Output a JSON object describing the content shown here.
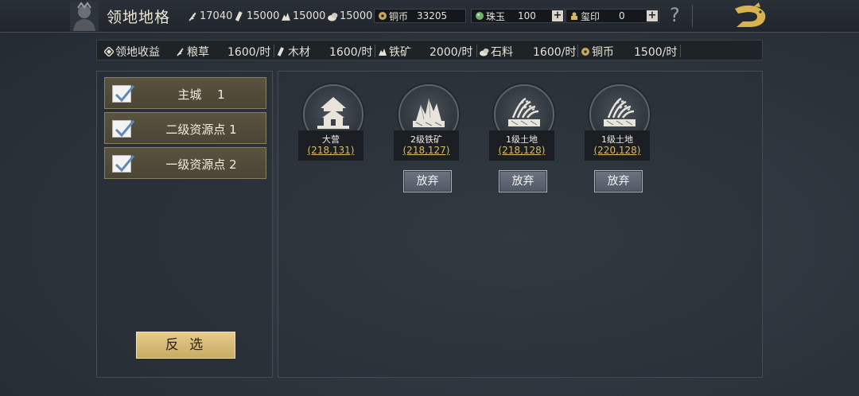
{
  "header": {
    "title": "领地地格",
    "resources": [
      {
        "icon": "grain-icon",
        "value": "17040"
      },
      {
        "icon": "wood-icon",
        "value": "15000"
      },
      {
        "icon": "iron-icon",
        "value": "15000"
      },
      {
        "icon": "stone-icon",
        "value": "15000"
      }
    ],
    "copper": {
      "label": "铜币",
      "value": "33205"
    },
    "jade": {
      "label": "珠玉",
      "value": "100"
    },
    "seal": {
      "label": "玺印",
      "value": "0"
    },
    "help": "?"
  },
  "income": {
    "title": "领地收益",
    "items": [
      {
        "label": "粮草",
        "value": "1600/时"
      },
      {
        "label": "木材",
        "value": "1600/时"
      },
      {
        "label": "铁矿",
        "value": "2000/时"
      },
      {
        "label": "石料",
        "value": "1600/时"
      },
      {
        "label": "铜币",
        "value": "1500/时"
      }
    ]
  },
  "filters": [
    {
      "label": "主城　  1",
      "checked": true
    },
    {
      "label": "二级资源点 1",
      "checked": true
    },
    {
      "label": "一级资源点 2",
      "checked": true
    }
  ],
  "invert_label": "反 选",
  "tiles": [
    {
      "name": "大营",
      "coord": "(218,131)",
      "icon": "camp-icon",
      "abandon": ""
    },
    {
      "name": "2级铁矿",
      "coord": "(218,127)",
      "icon": "iron-mine-icon",
      "abandon": "放弃"
    },
    {
      "name": "1级土地",
      "coord": "(218,128)",
      "icon": "farmland-icon",
      "abandon": "放弃"
    },
    {
      "name": "1级土地",
      "coord": "(220,128)",
      "icon": "farmland-icon",
      "abandon": "放弃"
    }
  ],
  "colors": {
    "accent": "#d9b96a",
    "button_gold": "#d8bd78",
    "panel": "#2c333b"
  }
}
